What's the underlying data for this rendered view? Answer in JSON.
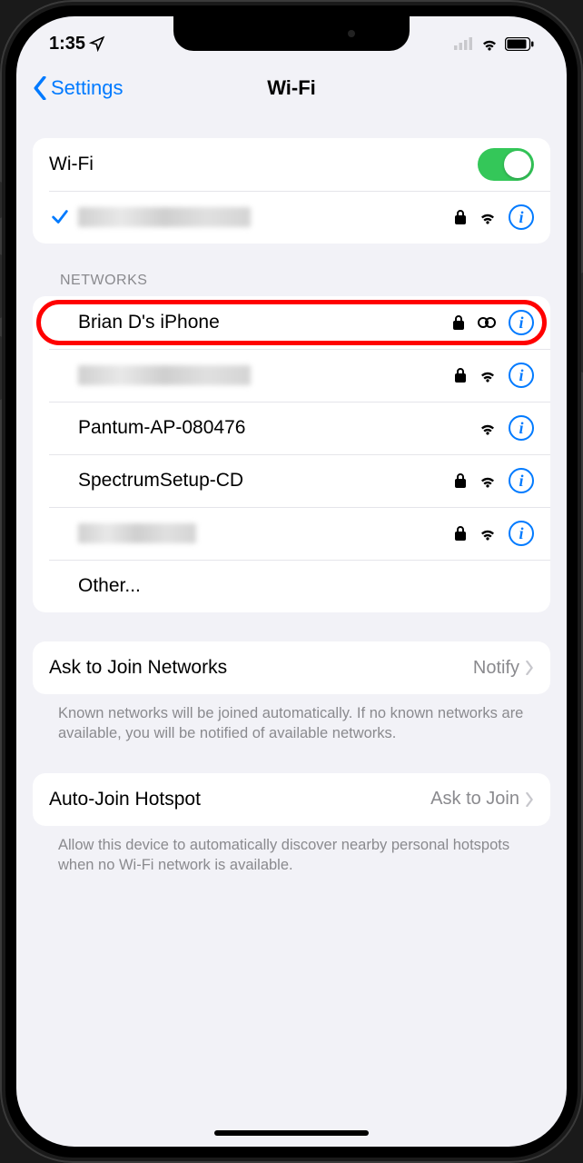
{
  "status": {
    "time": "1:35"
  },
  "nav": {
    "back": "Settings",
    "title": "Wi-Fi"
  },
  "wifi_section": {
    "toggle_label": "Wi-Fi",
    "toggle_on": true,
    "connected": {
      "name_redacted": true,
      "secured": true
    }
  },
  "networks_header": "NETWORKS",
  "networks": [
    {
      "name": "Brian D's iPhone",
      "secured": true,
      "signal_type": "hotspot",
      "highlighted": true
    },
    {
      "name_redacted": true,
      "secured": true,
      "signal_type": "wifi"
    },
    {
      "name": "Pantum-AP-080476",
      "secured": false,
      "signal_type": "wifi"
    },
    {
      "name": "SpectrumSetup-CD",
      "secured": true,
      "signal_type": "wifi"
    },
    {
      "name_redacted": true,
      "redact_short": true,
      "secured": true,
      "signal_type": "wifi"
    },
    {
      "name": "Other...",
      "is_other": true
    }
  ],
  "ask_join": {
    "label": "Ask to Join Networks",
    "value": "Notify",
    "footer": "Known networks will be joined automatically. If no known networks are available, you will be notified of available networks."
  },
  "auto_hotspot": {
    "label": "Auto-Join Hotspot",
    "value": "Ask to Join",
    "footer": "Allow this device to automatically discover nearby personal hotspots when no Wi-Fi network is available."
  }
}
